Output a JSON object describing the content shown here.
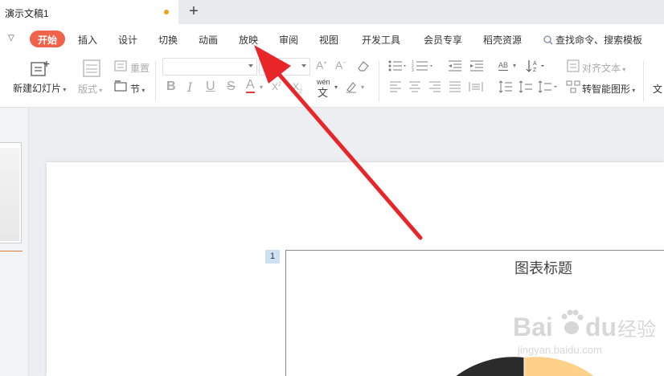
{
  "tab": {
    "title": "演示文稿1",
    "new_tab": "+"
  },
  "menu": {
    "items": [
      "开始",
      "插入",
      "设计",
      "切换",
      "动画",
      "放映",
      "审阅",
      "视图",
      "开发工具",
      "会员专享",
      "稻壳资源"
    ],
    "active": "开始",
    "search": "查找命令、搜索模板"
  },
  "ribbon": {
    "new_slide": "新建幻灯片",
    "layout": "版式",
    "reset": "重置",
    "section": "节",
    "align_text": "对齐文本",
    "smart_art": "转智能图形",
    "text_cut": "文",
    "wen": "wén",
    "ab": "AB"
  },
  "chart": {
    "number": "1",
    "title": "图表标题"
  },
  "watermark": {
    "brand": "Bai",
    "brand2": "经验",
    "url": "jingyan.baidu.com"
  },
  "colors": {
    "accent": "#f0624a",
    "arrow": "#e8262a",
    "pie_dark": "#2b2b2b",
    "pie_light": "#fdd18a"
  }
}
